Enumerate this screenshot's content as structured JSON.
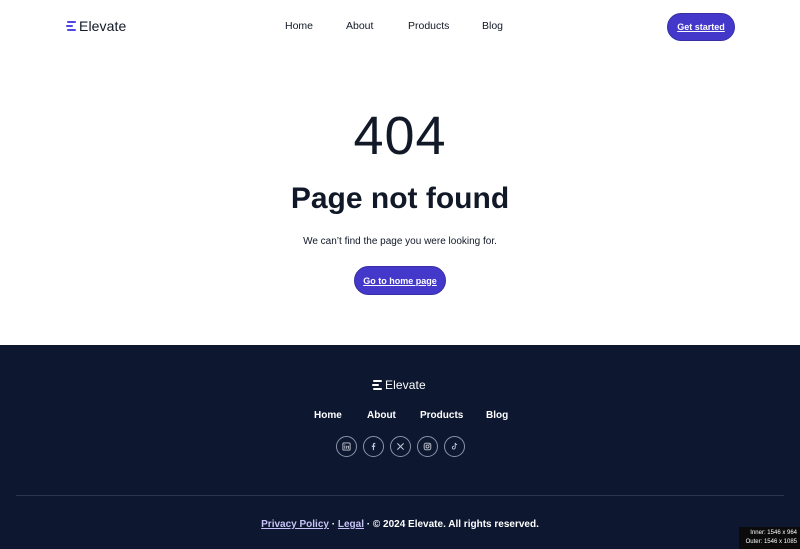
{
  "header": {
    "logo_text": "Elevate",
    "nav": [
      "Home",
      "About",
      "Products",
      "Blog"
    ],
    "cta_label": "Get started"
  },
  "main": {
    "error_code": "404",
    "title": "Page not found",
    "description": "We can’t find the page you were looking for.",
    "home_button_label": "Go to home page"
  },
  "footer": {
    "logo_text": "Elevate",
    "nav": [
      "Home",
      "About",
      "Products",
      "Blog"
    ],
    "socials": [
      "linkedin-icon",
      "facebook-icon",
      "x-icon",
      "instagram-icon",
      "tiktok-icon"
    ],
    "legal": {
      "privacy": "Privacy Policy",
      "sep1": " · ",
      "legal": "Legal",
      "rest": " · © 2024 Elevate. All rights reserved."
    }
  },
  "overlay": {
    "inner": "Inner: 1546 x 964",
    "outer": "Outer: 1546 x 1085"
  },
  "colors": {
    "accent": "#4338ca",
    "footer_bg": "#0d1730",
    "text": "#111827"
  }
}
